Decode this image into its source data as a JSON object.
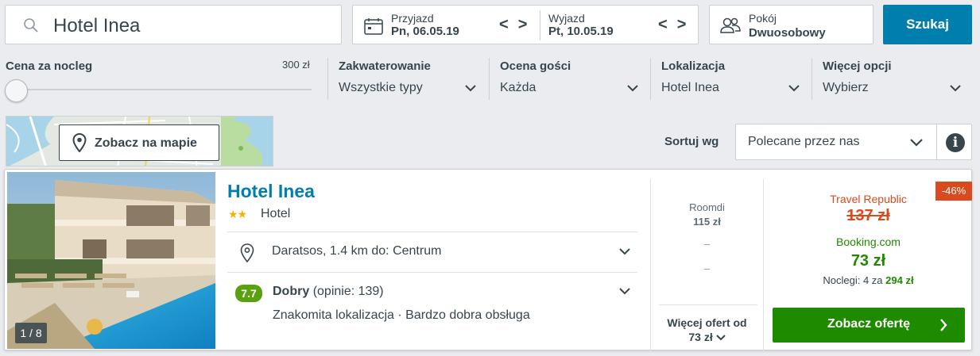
{
  "search": {
    "destination": "Hotel Inea",
    "checkin_label": "Przyjazd",
    "checkin_value": "Pn, 06.05.19",
    "checkout_label": "Wyjazd",
    "checkout_value": "Pt, 10.05.19",
    "rooms_label": "Pokój",
    "rooms_value": "Dwuosobowy",
    "search_button": "Szukaj",
    "prev_arrow": "<",
    "next_arrow": ">"
  },
  "filters": {
    "price_title": "Cena za nocleg",
    "price_max": "300 zł",
    "price_slider_value": 0,
    "accommodation_title": "Zakwaterowanie",
    "accommodation_value": "Wszystkie typy",
    "rating_title": "Ocena gości",
    "rating_value": "Każda",
    "location_title": "Lokalizacja",
    "location_value": "Hotel Inea",
    "more_title": "Więcej opcji",
    "more_value": "Wybierz"
  },
  "map": {
    "button_label": "Zobacz na mapie"
  },
  "sort": {
    "label": "Sortuj wg",
    "selected": "Polecane przez nas",
    "info_glyph": "i"
  },
  "result": {
    "photo_counter": "1 / 8",
    "hotel_name": "Hotel Inea",
    "stars": "★★",
    "star_count": 2,
    "type": "Hotel",
    "location": "Daratsos, 1.4 km do: Centrum",
    "rating_score": "7.7",
    "rating_word": "Dobry",
    "rating_reviews": "(opinie: 139)",
    "rating_highlights": "Znakomita lokalizacja · Bardzo dobra obsługa",
    "other_provider": "Roomdi",
    "other_price": "115 zł",
    "dash": "–",
    "more_offers_label": "Więcej ofert od",
    "more_offers_price": "73 zł",
    "discount": "-46%",
    "old_provider": "Travel Republic",
    "old_price": "137 zł",
    "deal_provider": "Booking.com",
    "deal_price": "73 zł",
    "nights_text": "Noclegi: 4 za",
    "nights_total": "294 zł",
    "cta_label": "Zobacz ofertę"
  },
  "colors": {
    "brand_blue": "#007faf",
    "deal_green": "#1e8a00",
    "discount_red": "#d94a1e",
    "rating_green": "#5aa10f"
  }
}
